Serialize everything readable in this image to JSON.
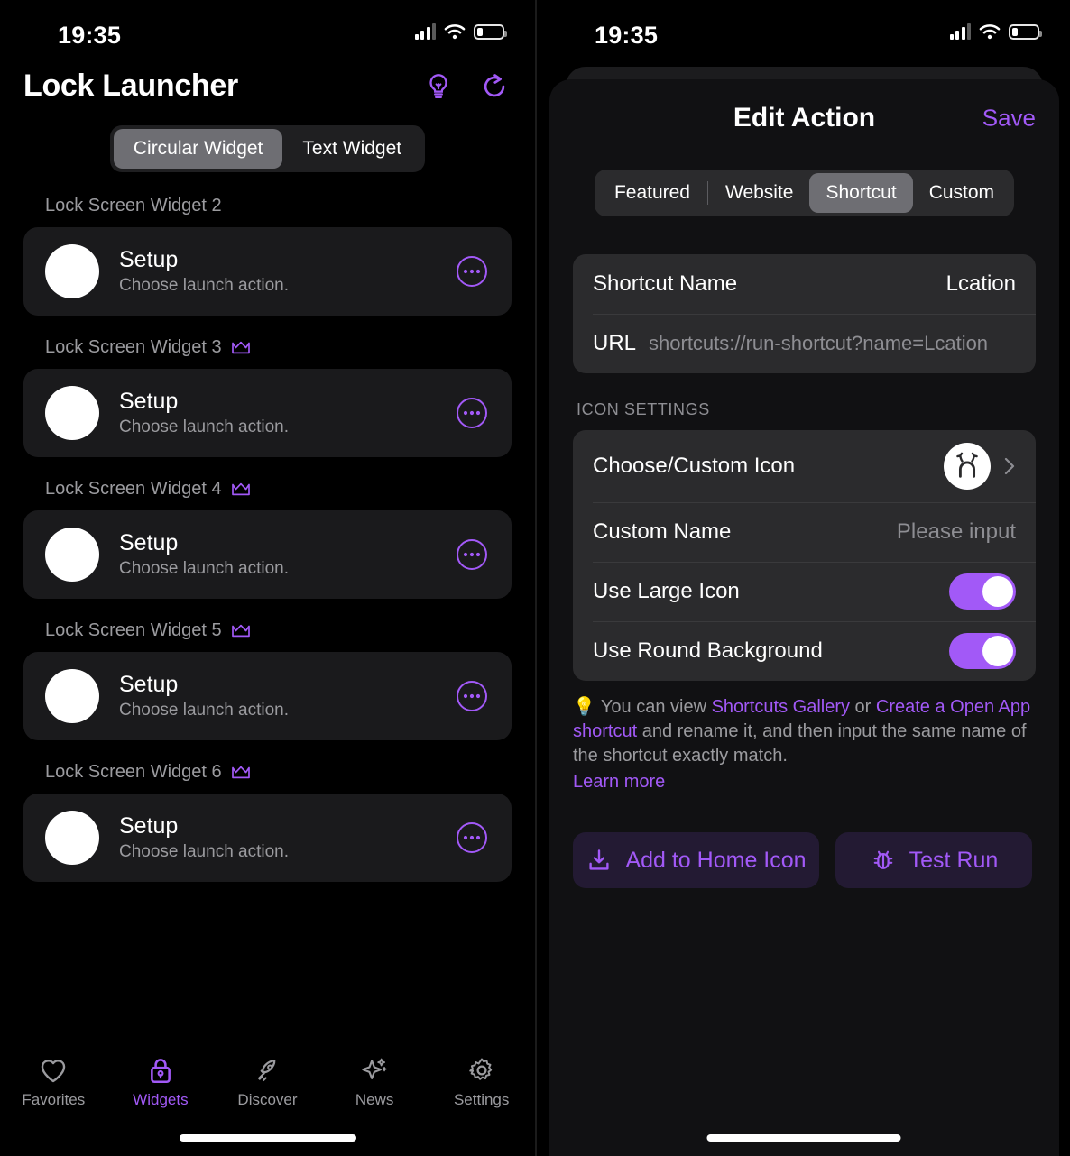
{
  "colors": {
    "accent": "#a259f7",
    "background": "#000000",
    "card": "#1a1a1c",
    "sheet_card": "#2b2b2d",
    "muted_text": "#9b9b9f"
  },
  "left": {
    "status_bar": {
      "time": "19:35",
      "signal_icon": "cellular-bars-icon",
      "wifi_icon": "wifi-icon",
      "battery_icon": "battery-low-icon",
      "battery_level_pct": 22
    },
    "header": {
      "title": "Lock Launcher",
      "tip_icon": "lightbulb-icon",
      "refresh_icon": "refresh-icon"
    },
    "segmented": {
      "items": [
        {
          "label": "Circular Widget",
          "active": true
        },
        {
          "label": "Text Widget",
          "active": false
        }
      ]
    },
    "widgets": [
      {
        "group_label": "Lock Screen Widget 2",
        "premium": false,
        "title": "Setup",
        "subtitle": "Choose launch action.",
        "more_icon": "more-ellipsis-icon"
      },
      {
        "group_label": "Lock Screen Widget 3",
        "premium": true,
        "title": "Setup",
        "subtitle": "Choose launch action.",
        "more_icon": "more-ellipsis-icon"
      },
      {
        "group_label": "Lock Screen Widget 4",
        "premium": true,
        "title": "Setup",
        "subtitle": "Choose launch action.",
        "more_icon": "more-ellipsis-icon"
      },
      {
        "group_label": "Lock Screen Widget 5",
        "premium": true,
        "title": "Setup",
        "subtitle": "Choose launch action.",
        "more_icon": "more-ellipsis-icon"
      },
      {
        "group_label": "Lock Screen Widget 6",
        "premium": true,
        "title": "Setup",
        "subtitle": "Choose launch action.",
        "more_icon": "more-ellipsis-icon"
      }
    ],
    "tabbar": [
      {
        "label": "Favorites",
        "icon": "heart-icon",
        "active": false
      },
      {
        "label": "Widgets",
        "icon": "lock-icon",
        "active": true
      },
      {
        "label": "Discover",
        "icon": "rocket-icon",
        "active": false
      },
      {
        "label": "News",
        "icon": "sparkles-icon",
        "active": false
      },
      {
        "label": "Settings",
        "icon": "gear-icon",
        "active": false
      }
    ]
  },
  "right": {
    "status_bar": {
      "time": "19:35",
      "signal_icon": "cellular-bars-icon",
      "wifi_icon": "wifi-icon",
      "battery_icon": "battery-low-icon",
      "battery_level_pct": 22
    },
    "sheet": {
      "title": "Edit Action",
      "save_label": "Save",
      "segmented": {
        "items": [
          {
            "label": "Featured",
            "active": false
          },
          {
            "label": "Website",
            "active": false
          },
          {
            "label": "Shortcut",
            "active": true
          },
          {
            "label": "Custom",
            "active": false
          }
        ]
      },
      "shortcut": {
        "name_label": "Shortcut Name",
        "name_value": "Lcation",
        "url_label": "URL",
        "url_value": "shortcuts://run-shortcut?name=Lcation"
      },
      "icon_settings": {
        "section_label": "ICON SETTINGS",
        "choose_icon_label": "Choose/Custom Icon",
        "choose_icon_preview": "reindeer-antlers-icon",
        "chevron_icon": "chevron-right-icon",
        "custom_name_label": "Custom Name",
        "custom_name_placeholder": "Please input",
        "use_large_icon_label": "Use Large Icon",
        "use_large_icon_on": true,
        "use_round_background_label": "Use Round Background",
        "use_round_background_on": true
      },
      "hint": {
        "bulb_icon": "lightbulb-emoji",
        "part1": "You can view ",
        "link1": "Shortcuts Gallery",
        "part2": " or ",
        "link2": "Create a Open App shortcut",
        "part3": " and rename it, and then input the same name of the shortcut exactly match.",
        "learn_more": "Learn more"
      },
      "actions": [
        {
          "label": "Add to Home Icon",
          "icon": "download-icon"
        },
        {
          "label": "Test Run",
          "icon": "bug-icon"
        }
      ]
    }
  }
}
